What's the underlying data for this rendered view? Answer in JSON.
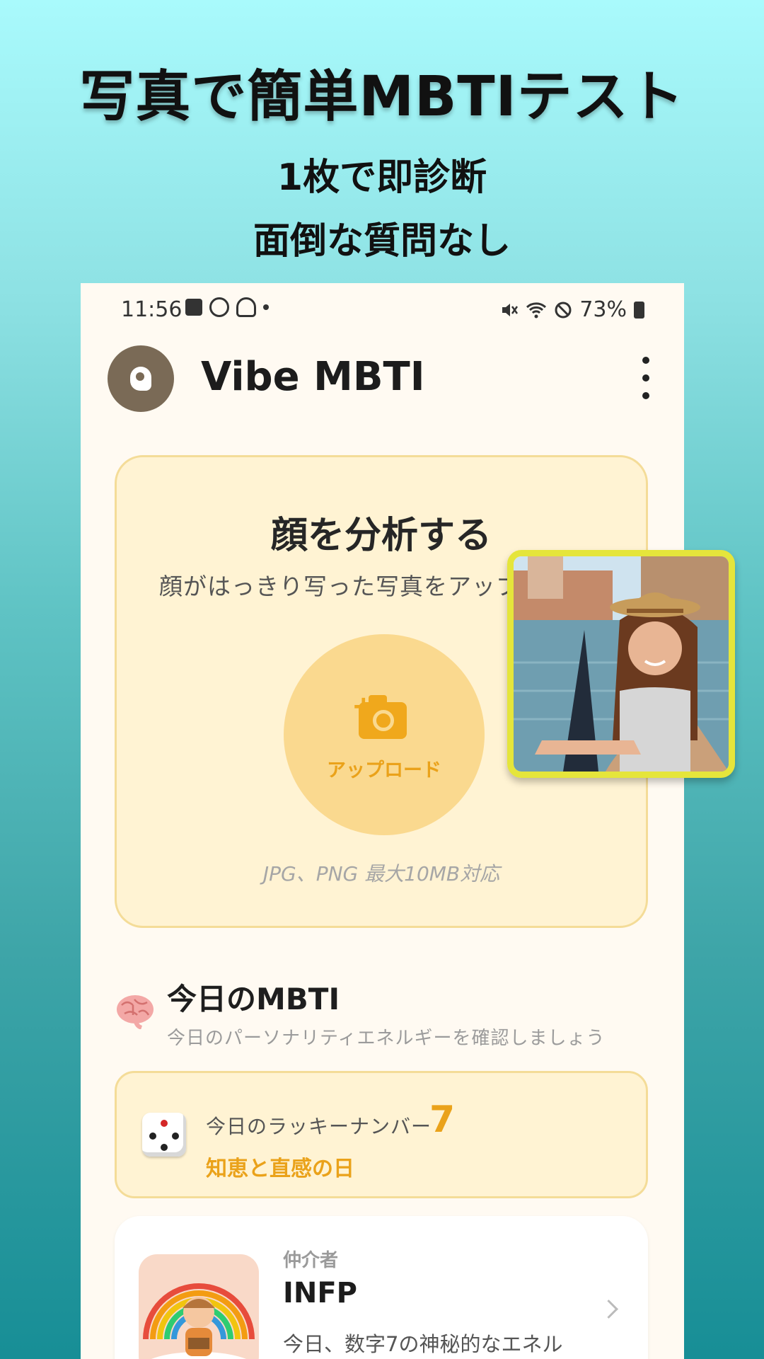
{
  "promo": {
    "headline": "写真で簡単MBTIテスト",
    "sub_line1": "1枚で即診断",
    "sub_line2": "面倒な質問なし"
  },
  "status_bar": {
    "time": "11:56",
    "battery": "73%",
    "left_icons": [
      "gallery-icon",
      "stopwatch-icon",
      "bell-icon",
      "dot-icon"
    ],
    "right_icons": [
      "mute-icon",
      "wifi-icon",
      "blocked-icon",
      "battery-icon"
    ]
  },
  "app_bar": {
    "title": "Vibe MBTI"
  },
  "analyze": {
    "title": "顔を分析する",
    "description": "顔がはっきり写った写真をアップ",
    "upload_label": "アップロード",
    "formats": "JPG、PNG 最大10MB対応"
  },
  "today": {
    "title": "今日のMBTI",
    "subtitle": "今日のパーソナリティエネルギーを確認しましょう",
    "lucky_label": "今日のラッキーナンバー",
    "lucky_number": "7",
    "theme": "知恵と直感の日"
  },
  "mbti_card": {
    "type_name": "仲介者",
    "code": "INFP",
    "description": "今日、数字7の神秘的なエネル"
  },
  "colors": {
    "accent": "#eaa21a",
    "card_bg": "#fff3d3",
    "photo_border": "#e5e53b",
    "app_logo": "#7a6a56"
  }
}
